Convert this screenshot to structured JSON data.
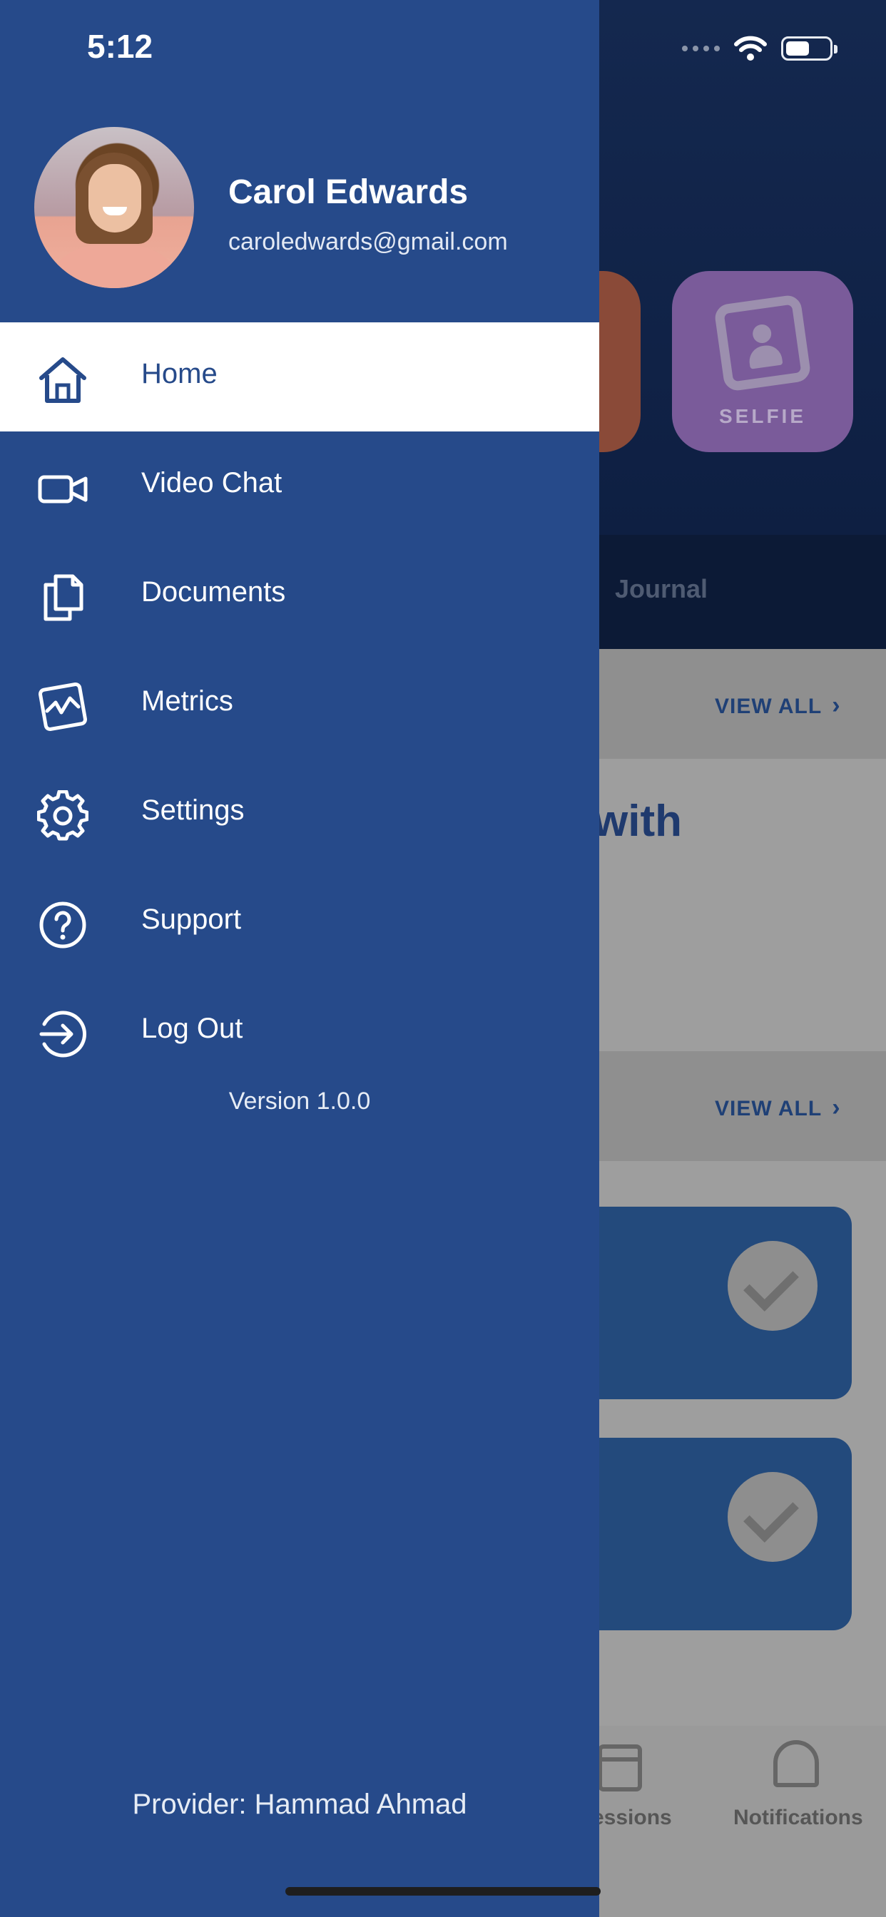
{
  "status_bar": {
    "time": "5:12"
  },
  "drawer": {
    "profile": {
      "name": "Carol Edwards",
      "email": "caroledwards@gmail.com"
    },
    "menu": [
      {
        "label": "Home",
        "icon": "home-icon",
        "active": true
      },
      {
        "label": "Video Chat",
        "icon": "video-camera-icon"
      },
      {
        "label": "Documents",
        "icon": "documents-icon"
      },
      {
        "label": "Metrics",
        "icon": "metrics-icon"
      },
      {
        "label": "Settings",
        "icon": "gear-icon"
      },
      {
        "label": "Support",
        "icon": "help-circle-icon"
      },
      {
        "label": "Log Out",
        "icon": "logout-icon"
      }
    ],
    "version": "Version 1.0.0",
    "provider": "Provider: Hammad Ahmad"
  },
  "background": {
    "selfie_label": "SELFIE",
    "journal_tab": "Journal",
    "view_all": "VIEW ALL",
    "partial_heading": "with",
    "sessions_tab": "essions",
    "notifications_tab": "Notifications"
  },
  "colors": {
    "drawer_bg": "#264a8a",
    "active_item_bg": "#ffffff",
    "accent_text": "#264a8a"
  }
}
